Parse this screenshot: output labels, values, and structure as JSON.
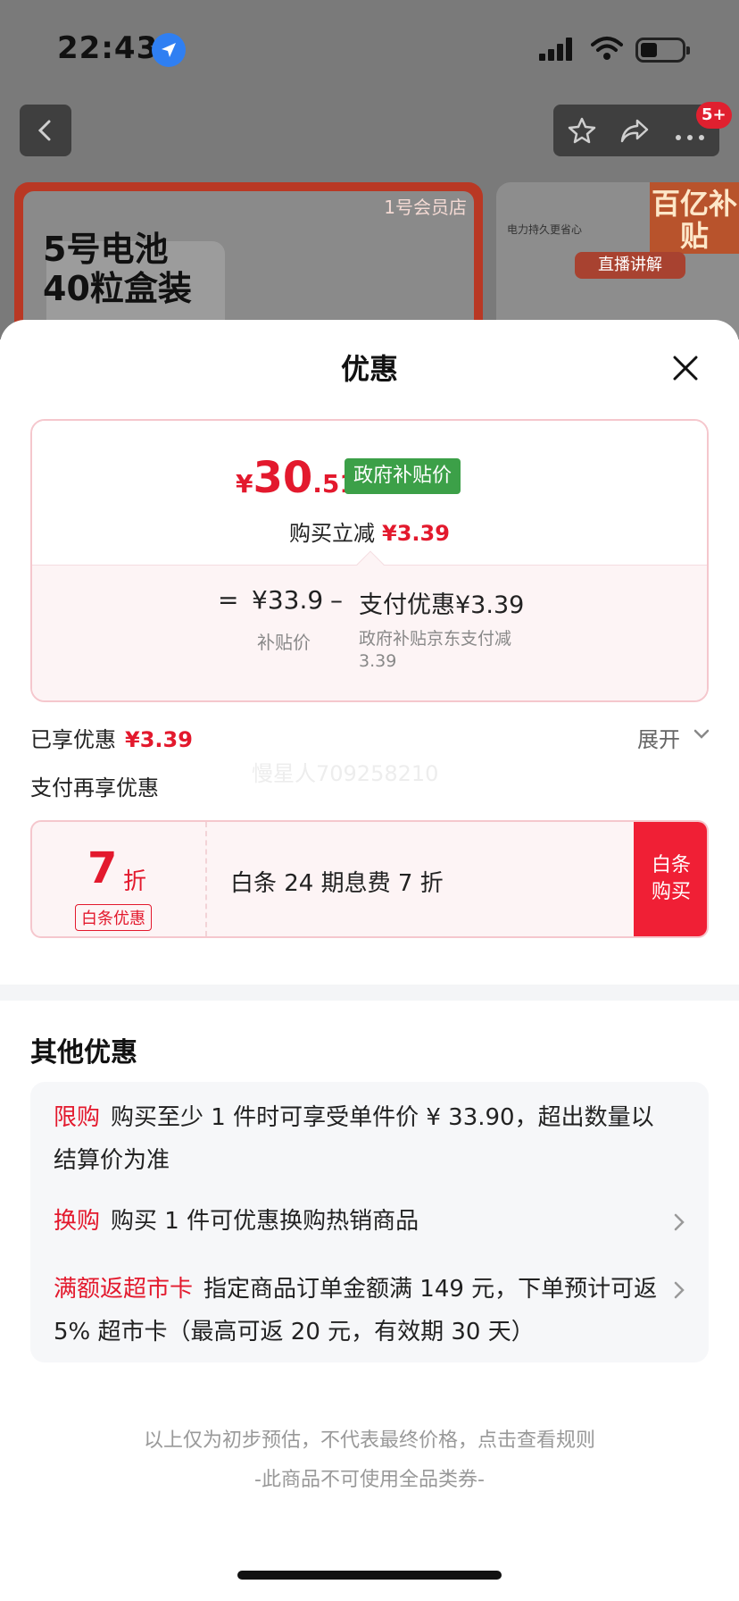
{
  "status_bar": {
    "time": "22:43",
    "icons": [
      "location-arrow-icon",
      "signal-icon",
      "wifi-icon",
      "battery-icon"
    ]
  },
  "background": {
    "nav_badge": "5+",
    "left_card": {
      "store": "1号会员店",
      "title_line1": "5号电池",
      "title_line2": "40粒盒装"
    },
    "right_card": {
      "tag": "百亿补贴",
      "live": "直播讲解",
      "desc": "电力持久更省心"
    }
  },
  "sheet": {
    "title": "优惠",
    "price": {
      "yen": "¥",
      "int": "30",
      "dec": ".51",
      "tag": "政府补贴价",
      "reduce_label": "购买立减",
      "reduce_value": "¥3.39",
      "eq": "=",
      "sub_price": "¥33.9",
      "sub_price_label": "补贴价",
      "minus": "–",
      "pay_discount": "支付优惠¥3.39",
      "pay_discount_desc": "政府补贴京东支付减3.39"
    },
    "enjoyed_label": "已享优惠",
    "enjoyed_value": "¥3.39",
    "expand_label": "展开",
    "pay_more_label": "支付再享优惠",
    "watermark": "慢星人709258210",
    "coupon": {
      "discount": "7",
      "unit": "折",
      "tag": "白条优惠",
      "text": "白条 24 期息费 7 折",
      "button": "白条\n购买"
    },
    "other_title": "其他优惠",
    "other_items": [
      {
        "tag": "限购",
        "text": "购买至少 1 件时可享受单件价 ¥ 33.90，超出数量以结算价为准"
      },
      {
        "tag": "换购",
        "text": "购买 1 件可优惠换购热销商品"
      },
      {
        "tag": "满额返超市卡",
        "text": "指定商品订单金额满 149 元，下单预计可返 5% 超市卡（最高可返 20 元，有效期 30 天）"
      }
    ],
    "footer_line1": "以上仅为初步预估，不代表最终价格，点击查看规则",
    "footer_line2": "-此商品不可使用全品类券-"
  },
  "colors": {
    "accent_red": "#e3192d",
    "gov_green": "#3ca048",
    "button_red": "#f01f35"
  }
}
